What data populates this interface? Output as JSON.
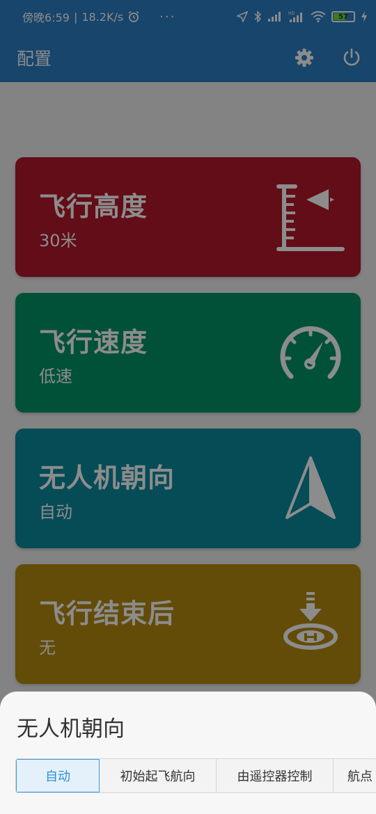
{
  "status_bar": {
    "time": "傍晚6:59",
    "speed": "18.2K/s",
    "more": "···",
    "battery_level": "57",
    "icons": [
      "alarm-icon",
      "location-icon",
      "bluetooth-icon",
      "signal-icon",
      "hd-signal-icon",
      "wifi-icon",
      "battery-icon",
      "charging-icon"
    ]
  },
  "app_bar": {
    "title": "配置",
    "icons": [
      "settings-icon",
      "power-icon"
    ]
  },
  "cards": [
    {
      "title": "飞行高度",
      "value": "30米",
      "color": "#b2182b",
      "icon": "altitude-icon"
    },
    {
      "title": "飞行速度",
      "value": "低速",
      "color": "#009467",
      "icon": "speedometer-icon"
    },
    {
      "title": "无人机朝向",
      "value": "自动",
      "color": "#0a8a9e",
      "icon": "navigation-arrow-icon"
    },
    {
      "title": "飞行结束后",
      "value": "无",
      "color": "#b48a0f",
      "icon": "landing-pad-icon"
    }
  ],
  "bottom_sheet": {
    "title": "无人机朝向",
    "options": [
      "自动",
      "初始起飞航向",
      "由遥控器控制",
      "航点"
    ],
    "selected": "自动"
  },
  "colors": {
    "primary": "#2a7fc3",
    "selected_segment": "#2f8fd6"
  }
}
